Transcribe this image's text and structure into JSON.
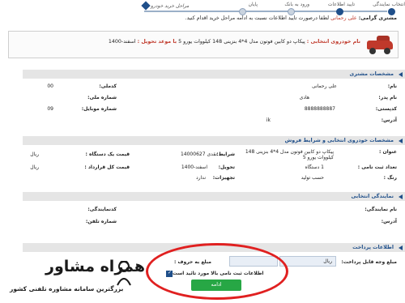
{
  "steps": [
    "انتخاب نمایندگی",
    "تایید اطلاعات",
    "ورود به بانک",
    "پایان"
  ],
  "logo_text": "مراحل خرید خودرو",
  "intro": {
    "greet": "مشتری گرامی:",
    "name": "علی رحمانی",
    "message": "لطفا درصورت تایید اطلاعات نسبت به ادامه مراحل خرید اقدام کنید."
  },
  "product": {
    "label": "نام خودروی انتخابی :",
    "name": "پیکاپ دو کابین فوتون مدل 4*4 بنزینی 148 کیلووات یورو 5",
    "delivery_label": "با موعد تحویل :",
    "delivery": "اسفند-1400"
  },
  "customer": {
    "title": "مشخصات مشتری",
    "name_label": "نام:",
    "name_value": "علی رحمانی",
    "code_label": "کدملی:",
    "code_value": "00",
    "father_label": "نام پدر:",
    "father_value": "هادی",
    "idnum_label": "شماره ملی:",
    "idnum_value": "",
    "postal_label": "کدپستی:",
    "postal_value": "8888888887",
    "mobile_label": "شماره موبایل:",
    "mobile_value": "09",
    "address_label": "آدرس:",
    "address_value": "ik"
  },
  "car": {
    "title": "مشخصات خودروی انتخابی و شرایط فروش",
    "title_label": "عنوان :",
    "title_value": "پیکاپ دو کابین فوتون مدل 4*4 بنزینی 148 کیلووات یورو 5",
    "terms_label": "شرایط:",
    "terms_value": "نقدی 14000627",
    "unit_price_label": "قیمت یک دستگاه :",
    "unit_price_currency": "ریال",
    "count_label": "تعداد ثبت نامی :",
    "count_value": "1 دستگاه",
    "delivery_label": "تحویل:",
    "delivery_value": "اسفند-1400",
    "total_label": "قیمت کل قرارداد :",
    "total_currency": "ریال",
    "color_label": "رنگ :",
    "color_value": "حسب تولید",
    "equip_label": "تجهیزات:",
    "equip_value": "ندارد"
  },
  "dealer": {
    "title": "نمایندگی انتخابی",
    "name_label": "نام نمایندگی:",
    "code_label": "کدنمایندگی:",
    "phone_label": "شماره تلفن:",
    "address_label": "آدرس:"
  },
  "payment": {
    "title": "اطلاعات پرداخت",
    "amount_label": "مبلغ وجه قابل پرداخت:",
    "amount_currency": "ریال",
    "words_label": "مبلغ به حروف :",
    "confirm_label": "اطلاعات ثبت نامی بالا مورد تائید است",
    "continue_label": "ادامه"
  },
  "brand": {
    "name": "همراه مشاور",
    "tagline": "بزرگترین سامانه مشاوره تلفنی کشور"
  }
}
